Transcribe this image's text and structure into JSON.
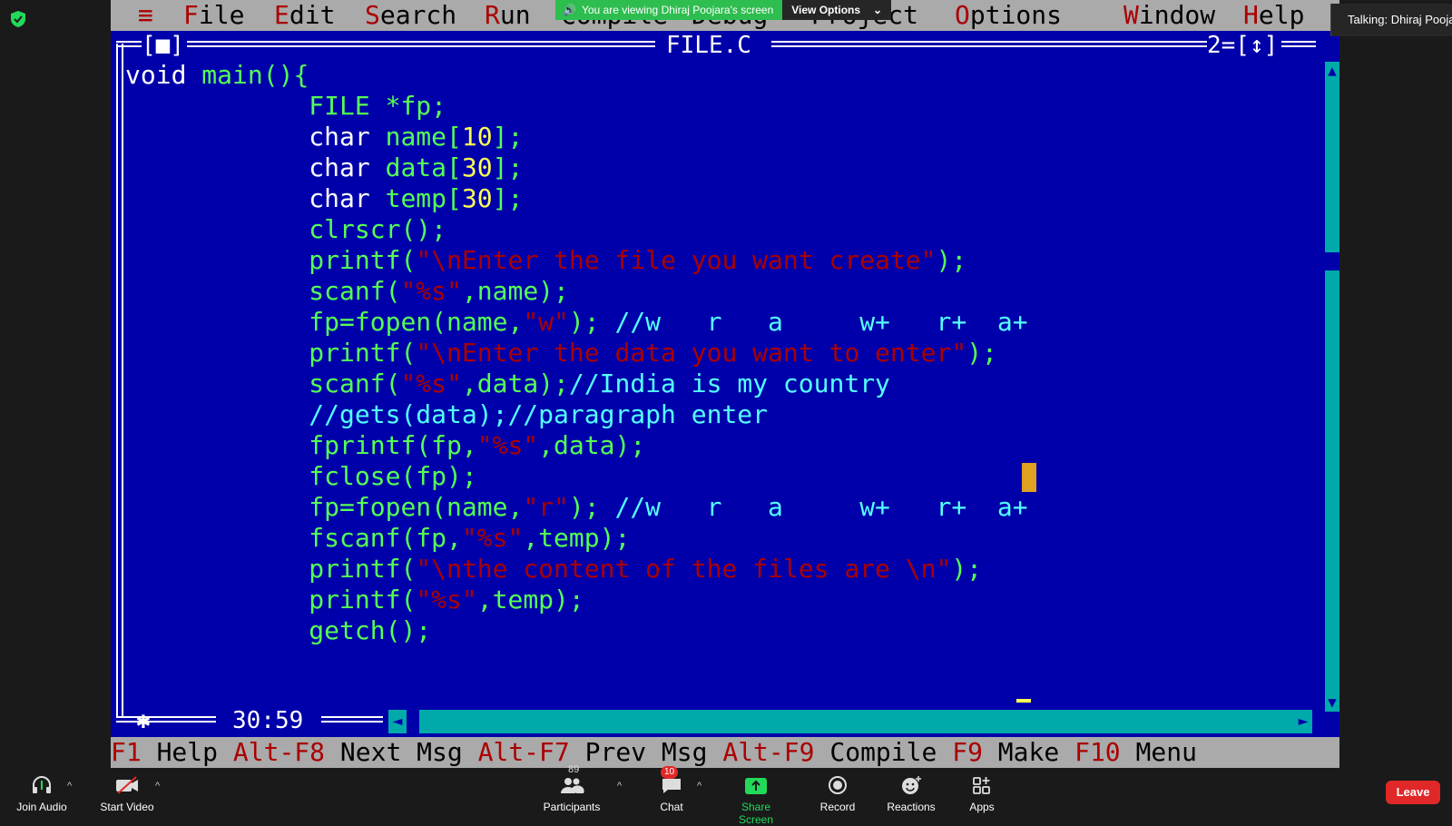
{
  "menu": {
    "items": [
      {
        "hk": "F",
        "rest": "ile"
      },
      {
        "hk": "E",
        "rest": "dit"
      },
      {
        "hk": "S",
        "rest": "earch"
      },
      {
        "hk": "R",
        "rest": "un"
      },
      {
        "hk": "",
        "rest": "Compile"
      },
      {
        "hk": "",
        "rest": "Debug"
      },
      {
        "hk": "",
        "rest": "Project"
      },
      {
        "hk": "O",
        "rest": "ptions"
      },
      {
        "hk": "W",
        "rest": "indow"
      },
      {
        "hk": "H",
        "rest": "elp"
      }
    ]
  },
  "banner": {
    "viewing_text": "You are viewing Dhiraj Poojara's screen",
    "view_options": "View Options"
  },
  "window": {
    "title": "FILE.C",
    "close_glyph": "[■]",
    "number_zoom": "2=[↕]",
    "cursor_position": "30:59"
  },
  "code_lines": [
    [
      {
        "c": "pl",
        "t": "void "
      },
      {
        "c": "id",
        "t": "main(){"
      }
    ],
    [
      {
        "c": "pl",
        "t": "            "
      },
      {
        "c": "id",
        "t": "FILE *fp;"
      }
    ],
    [
      {
        "c": "pl",
        "t": "            "
      },
      {
        "c": "kw",
        "t": "char "
      },
      {
        "c": "id",
        "t": "name["
      },
      {
        "c": "num",
        "t": "10"
      },
      {
        "c": "id",
        "t": "];"
      }
    ],
    [
      {
        "c": "pl",
        "t": "            "
      },
      {
        "c": "kw",
        "t": "char "
      },
      {
        "c": "id",
        "t": "data["
      },
      {
        "c": "num",
        "t": "30"
      },
      {
        "c": "id",
        "t": "];"
      }
    ],
    [
      {
        "c": "pl",
        "t": "            "
      },
      {
        "c": "kw",
        "t": "char "
      },
      {
        "c": "id",
        "t": "temp["
      },
      {
        "c": "num",
        "t": "30"
      },
      {
        "c": "id",
        "t": "];"
      }
    ],
    [
      {
        "c": "pl",
        "t": "            "
      },
      {
        "c": "id",
        "t": "clrscr();"
      }
    ],
    [
      {
        "c": "pl",
        "t": "            "
      },
      {
        "c": "id",
        "t": "printf("
      },
      {
        "c": "str",
        "t": "\"\\nEnter the file you want create\""
      },
      {
        "c": "id",
        "t": ");"
      }
    ],
    [
      {
        "c": "pl",
        "t": "            "
      },
      {
        "c": "id",
        "t": "scanf("
      },
      {
        "c": "str",
        "t": "\"%s\""
      },
      {
        "c": "id",
        "t": ",name);"
      }
    ],
    [
      {
        "c": "pl",
        "t": "            "
      },
      {
        "c": "id",
        "t": "fp=fopen(name,"
      },
      {
        "c": "str",
        "t": "\"w\""
      },
      {
        "c": "id",
        "t": "); "
      },
      {
        "c": "cm",
        "t": "//w   r   a     w+   r+  a+"
      }
    ],
    [
      {
        "c": "pl",
        "t": "            "
      },
      {
        "c": "id",
        "t": "printf("
      },
      {
        "c": "str",
        "t": "\"\\nEnter the data you want to enter\""
      },
      {
        "c": "id",
        "t": ");"
      }
    ],
    [
      {
        "c": "pl",
        "t": "            "
      },
      {
        "c": "id",
        "t": "scanf("
      },
      {
        "c": "str",
        "t": "\"%s\""
      },
      {
        "c": "id",
        "t": ",data);"
      },
      {
        "c": "cm",
        "t": "//India is my country"
      }
    ],
    [
      {
        "c": "pl",
        "t": "            "
      },
      {
        "c": "cm",
        "t": "//gets(data);//paragraph enter"
      }
    ],
    [
      {
        "c": "pl",
        "t": "            "
      },
      {
        "c": "id",
        "t": "fprintf(fp,"
      },
      {
        "c": "str",
        "t": "\"%s\""
      },
      {
        "c": "id",
        "t": ",data);"
      }
    ],
    [
      {
        "c": "pl",
        "t": "            "
      },
      {
        "c": "id",
        "t": "fclose(fp);"
      }
    ],
    [
      {
        "c": "pl",
        "t": "            "
      },
      {
        "c": "id",
        "t": "fp=fopen(name,"
      },
      {
        "c": "str",
        "t": "\"r\""
      },
      {
        "c": "id",
        "t": "); "
      },
      {
        "c": "cm",
        "t": "//w   r   a     w+   r+  a+"
      }
    ],
    [
      {
        "c": "pl",
        "t": "            "
      },
      {
        "c": "id",
        "t": "fscanf(fp,"
      },
      {
        "c": "str",
        "t": "\"%s\""
      },
      {
        "c": "id",
        "t": ",temp);"
      }
    ],
    [
      {
        "c": "pl",
        "t": "            "
      },
      {
        "c": "id",
        "t": "printf("
      },
      {
        "c": "str",
        "t": "\"\\nthe content of the files are \\n\""
      },
      {
        "c": "id",
        "t": ");"
      }
    ],
    [
      {
        "c": "pl",
        "t": "            "
      },
      {
        "c": "id",
        "t": "printf("
      },
      {
        "c": "str",
        "t": "\"%s\""
      },
      {
        "c": "id",
        "t": ",temp);"
      }
    ],
    [
      {
        "c": "pl",
        "t": "            "
      },
      {
        "c": "id",
        "t": "getch();"
      }
    ]
  ],
  "status": [
    {
      "key": "F1",
      "label": " Help  "
    },
    {
      "key": "Alt-F8",
      "label": " Next Msg  "
    },
    {
      "key": "Alt-F7",
      "label": " Prev Msg  "
    },
    {
      "key": "Alt-F9",
      "label": " Compile  "
    },
    {
      "key": "F9",
      "label": " Make  "
    },
    {
      "key": "F10",
      "label": " Menu"
    }
  ],
  "talking": "Talking: Dhiraj Poojara",
  "toolbar": {
    "join_audio": "Join Audio",
    "start_video": "Start Video",
    "participants": "Participants",
    "participants_count": "89",
    "chat": "Chat",
    "chat_badge": "10",
    "share_screen": "Share Screen",
    "record": "Record",
    "reactions": "Reactions",
    "apps": "Apps",
    "leave": "Leave"
  },
  "colors": {
    "tc_blue": "#0000aa",
    "tc_gray": "#aaaaaa",
    "share_green": "#2ebd4f",
    "leave_red": "#e02828"
  }
}
